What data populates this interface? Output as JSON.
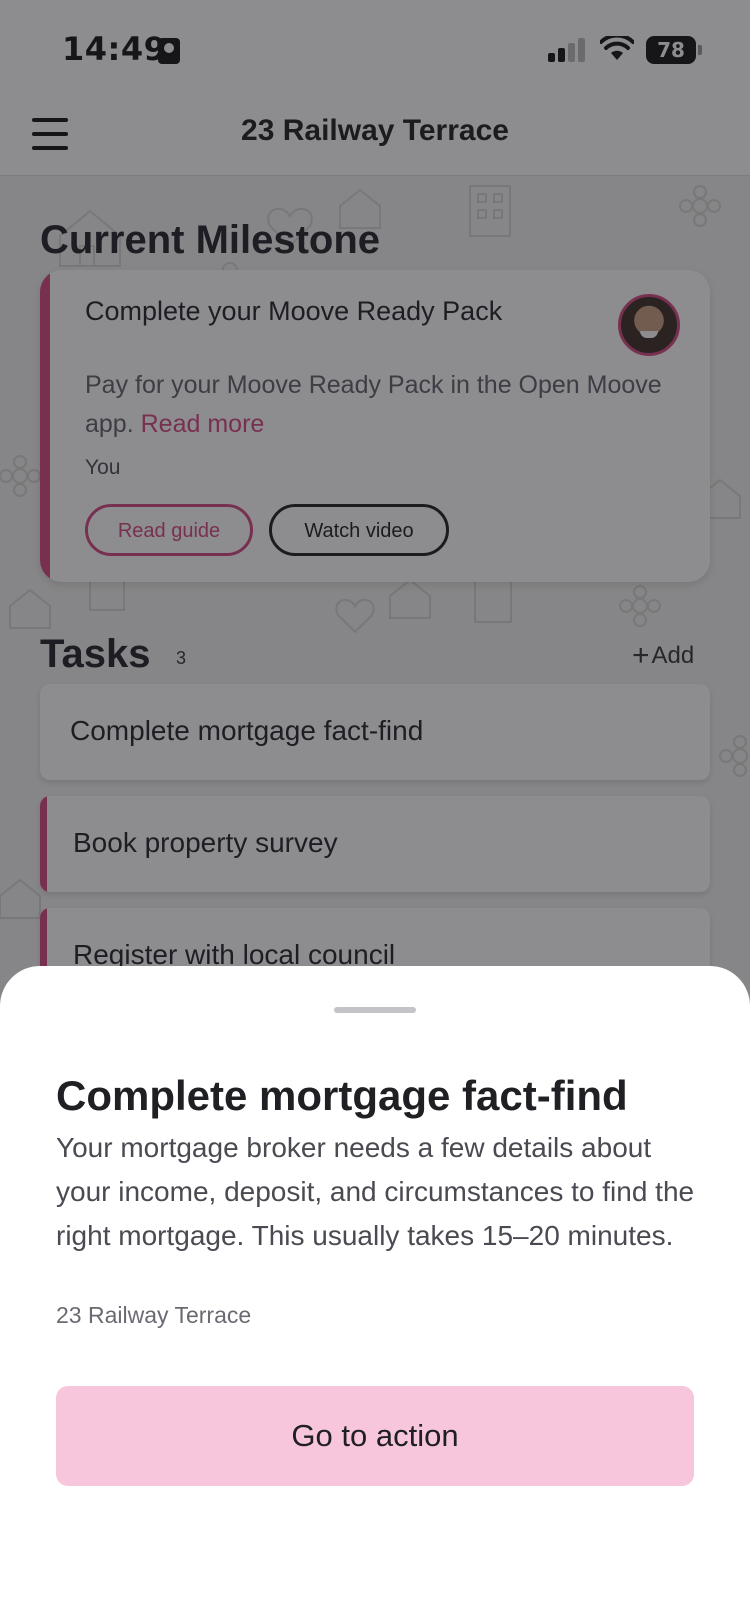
{
  "status_bar": {
    "time": "14:49",
    "battery": "78"
  },
  "header": {
    "title": "23 Railway Terrace"
  },
  "milestone": {
    "section_title": "Current Milestone",
    "card_title": "Complete your Moove Ready Pack",
    "body": "Pay for your Moove Ready Pack in the Open Moove app.",
    "read_more": "Read more",
    "owner": "You",
    "read_guide": "Read guide",
    "watch_video": "Watch video"
  },
  "tasks": {
    "section_title": "Tasks",
    "count": "3",
    "add_label": "Add",
    "items": [
      {
        "label": "Complete mortgage fact-find"
      },
      {
        "label": "Book property survey"
      },
      {
        "label": "Register with local council"
      }
    ]
  },
  "sheet": {
    "title": "Complete mortgage fact-find",
    "description": "Your mortgage broker needs a few details about your income, deposit, and circumstances to find the right mortgage. This usually takes 15–20 minutes.",
    "address": "23 Railway Terrace",
    "action_label": "Go to action"
  },
  "colors": {
    "accent": "#d4457f",
    "action_button": "#f7c6dc",
    "scrim": "rgba(28,28,34,0.5)"
  }
}
